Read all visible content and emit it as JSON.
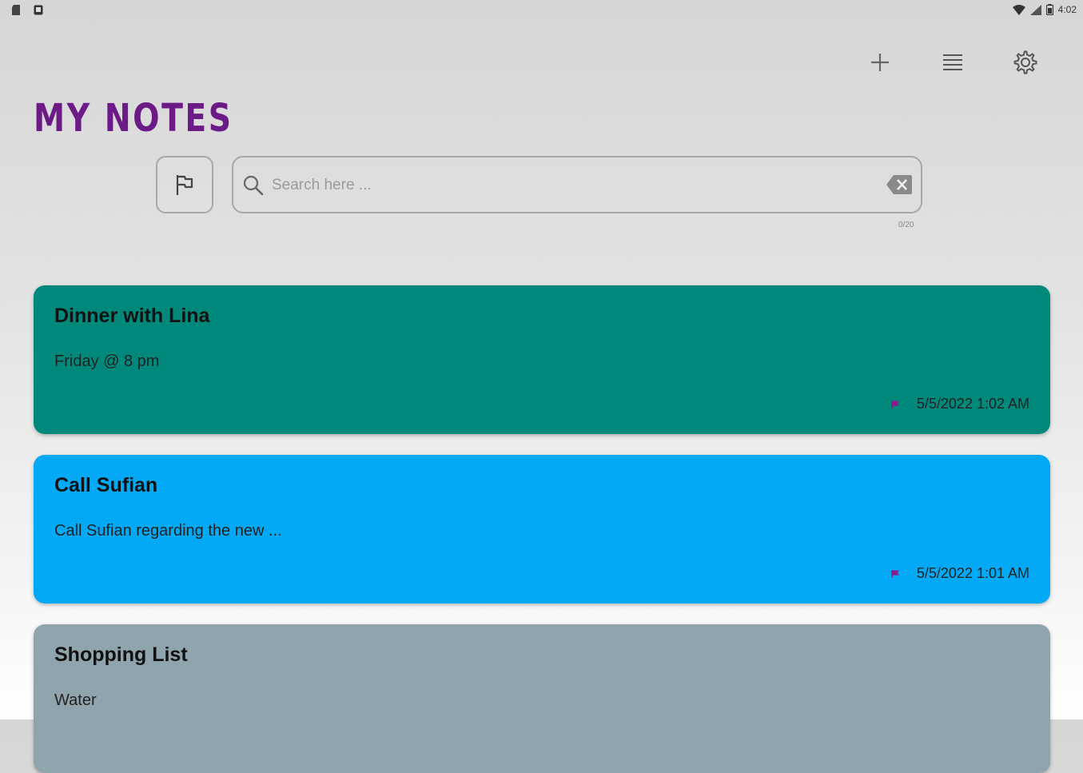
{
  "status_bar": {
    "time": "4:02",
    "left_icons": [
      "sd-card-icon",
      "notification-icon"
    ],
    "right_icons": [
      "wifi-icon",
      "signal-icon",
      "battery-icon"
    ]
  },
  "toolbar": {
    "add_icon": "plus-icon",
    "list_icon": "list-view-icon",
    "settings_icon": "gear-icon"
  },
  "header": {
    "title": "MY NOTES"
  },
  "search": {
    "placeholder": "Search here ...",
    "value": "",
    "char_count": "0/20"
  },
  "notes": [
    {
      "title": "Dinner with Lina",
      "body": "Friday @ 8 pm",
      "date": "5/5/2022 1:02 AM",
      "color": "#00887a",
      "flagged": true,
      "flag_color": "#8b1a8a"
    },
    {
      "title": "Call Sufian",
      "body": "Call Sufian regarding the new ...",
      "date": "5/5/2022 1:01 AM",
      "color": "#03a9f4",
      "flagged": true,
      "flag_color": "#8b1a8a"
    },
    {
      "title": "Shopping List",
      "body": "Water",
      "date": "",
      "color": "#90a4ae",
      "flagged": false,
      "flag_color": "#8b1a8a"
    }
  ],
  "colors": {
    "title": "#6b1a86",
    "border": "#a8a8a8"
  }
}
